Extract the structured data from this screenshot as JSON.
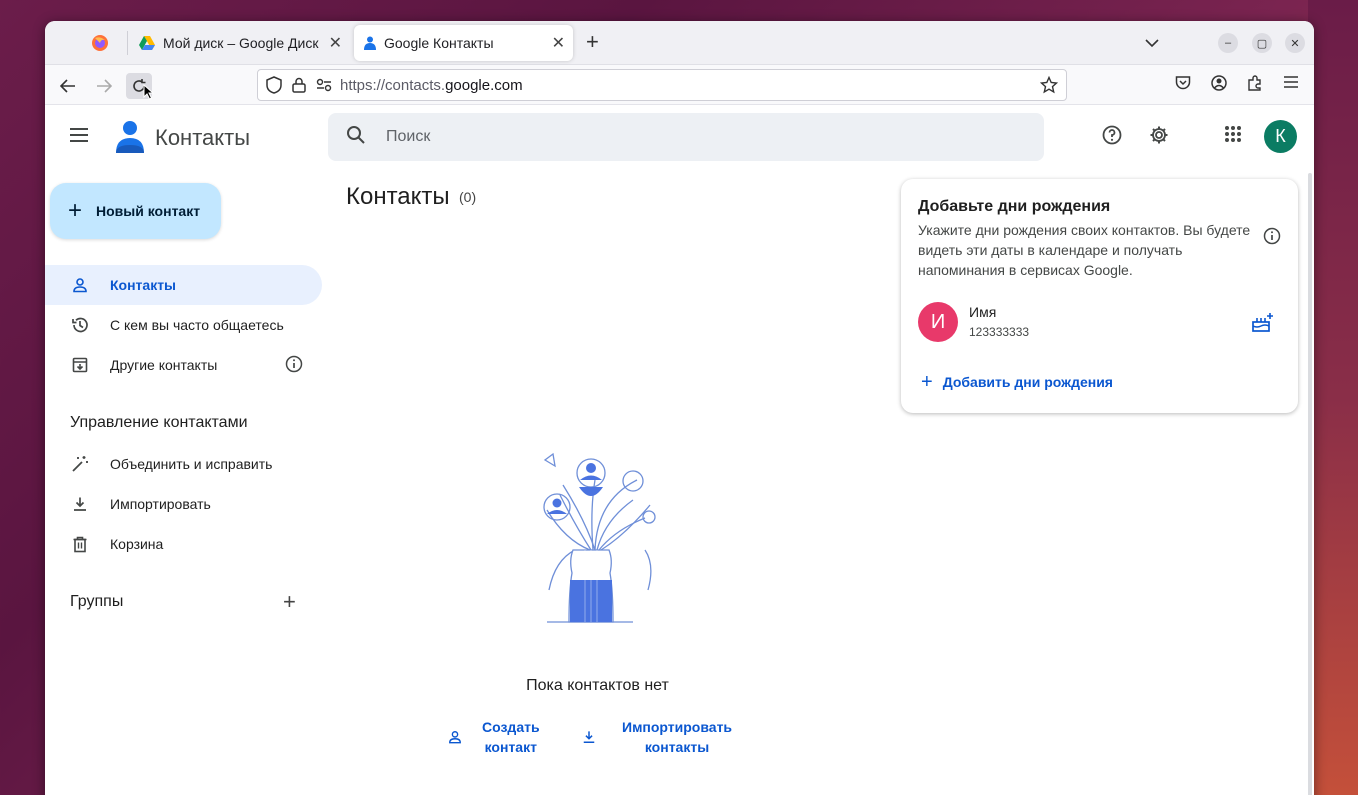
{
  "browser": {
    "tabs": [
      {
        "label": "Мой диск – Google Диск"
      },
      {
        "label": "Google Контакты"
      }
    ],
    "url_prefix": "https://contacts.",
    "url_domain": "google.com"
  },
  "app": {
    "title": "Контакты",
    "search_placeholder": "Поиск",
    "avatar_letter": "К"
  },
  "sidebar": {
    "new_contact_label": "Новый контакт",
    "items": [
      {
        "label": "Контакты"
      },
      {
        "label": "С кем вы часто общаетесь"
      },
      {
        "label": "Другие контакты"
      }
    ],
    "manage_heading": "Управление контактами",
    "manage_items": [
      {
        "label": "Объединить и исправить"
      },
      {
        "label": "Импортировать"
      },
      {
        "label": "Корзина"
      }
    ],
    "groups_heading": "Группы"
  },
  "main": {
    "title": "Контакты",
    "count": "(0)",
    "empty_text": "Пока контактов нет",
    "create_line1": "Создать",
    "create_line2": "контакт",
    "import_line1": "Импортировать",
    "import_line2": "контакты"
  },
  "birthday_card": {
    "title": "Добавьте дни рождения",
    "description": "Укажите дни рождения своих контактов. Вы будете видеть эти даты в календаре и получать напоминания в сервисах Google.",
    "contact_initial": "И",
    "contact_name": "Имя",
    "contact_phone": "123333333",
    "add_label": "Добавить дни рождения"
  },
  "colors": {
    "accent": "#0b57d0",
    "new_contact_bg": "#c2e7ff",
    "avatar_bg": "#0b7c63",
    "card_avatar_bg": "#e8396a",
    "illustration_blue": "#4a73e0"
  }
}
